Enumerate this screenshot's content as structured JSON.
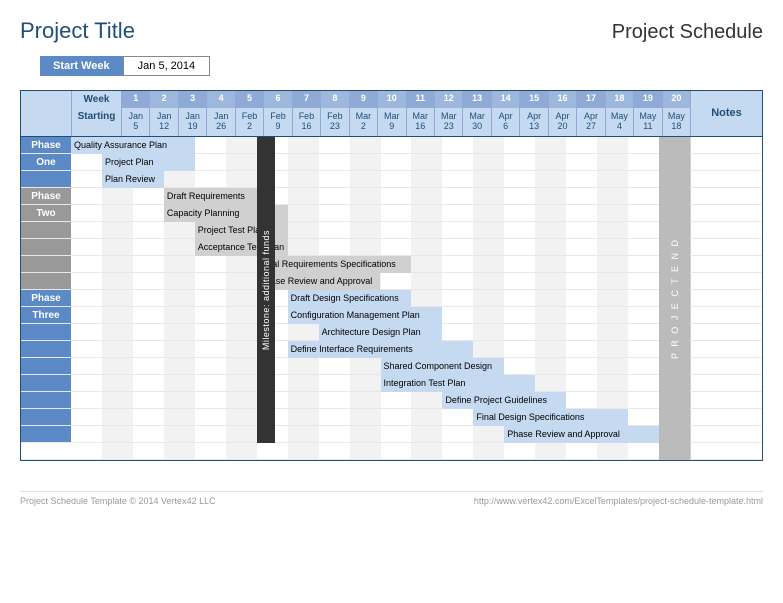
{
  "title": "Project Title",
  "subtitle": "Project Schedule",
  "start_week_label": "Start Week",
  "start_week_value": "Jan 5, 2014",
  "header": {
    "week_label": "Week",
    "starting_label": "Starting",
    "notes_label": "Notes",
    "weeks": [
      "1",
      "2",
      "3",
      "4",
      "5",
      "6",
      "7",
      "8",
      "9",
      "10",
      "11",
      "12",
      "13",
      "14",
      "15",
      "16",
      "17",
      "18",
      "19",
      "20"
    ],
    "dates": [
      "Jan 5",
      "Jan 12",
      "Jan 19",
      "Jan 26",
      "Feb 2",
      "Feb 9",
      "Feb 16",
      "Feb 23",
      "Mar 2",
      "Mar 9",
      "Mar 16",
      "Mar 23",
      "Mar 30",
      "Apr 6",
      "Apr 13",
      "Apr 20",
      "Apr 27",
      "May 4",
      "May 11",
      "May 18"
    ]
  },
  "phases": [
    {
      "name": "Phase",
      "sub": "One",
      "cls": "ph-one"
    },
    {
      "name": "Phase",
      "sub": "Two",
      "cls": "ph-two"
    },
    {
      "name": "Phase",
      "sub": "Three",
      "cls": "ph-three"
    }
  ],
  "chart_data": {
    "type": "bar",
    "xlabel": "Week",
    "categories": [
      "1",
      "2",
      "3",
      "4",
      "5",
      "6",
      "7",
      "8",
      "9",
      "10",
      "11",
      "12",
      "13",
      "14",
      "15",
      "16",
      "17",
      "18",
      "19",
      "20"
    ],
    "tasks": [
      {
        "row": 0,
        "start": 1,
        "span": 4,
        "label": "Quality Assurance Plan",
        "phase": 1
      },
      {
        "row": 1,
        "start": 2,
        "span": 3,
        "label": "Project Plan",
        "phase": 1
      },
      {
        "row": 2,
        "start": 2,
        "span": 2,
        "label": "Plan Review",
        "phase": 1
      },
      {
        "row": 3,
        "start": 4,
        "span": 3,
        "label": "Draft Requirements",
        "phase": 2
      },
      {
        "row": 4,
        "start": 4,
        "span": 4,
        "label": "Capacity Planning",
        "phase": 2
      },
      {
        "row": 5,
        "start": 5,
        "span": 3,
        "label": "Project Test Plan",
        "phase": 2
      },
      {
        "row": 6,
        "start": 5,
        "span": 3,
        "label": "Acceptance Test Plan",
        "phase": 2
      },
      {
        "row": 7,
        "start": 7,
        "span": 5,
        "label": "Final Requirements Specifications",
        "phase": 2
      },
      {
        "row": 8,
        "start": 7,
        "span": 4,
        "label": "Phase Review and Approval",
        "phase": 2
      },
      {
        "row": 9,
        "start": 8,
        "span": 4,
        "label": "Draft Design Specifications",
        "phase": 3
      },
      {
        "row": 10,
        "start": 8,
        "span": 5,
        "label": "Configuration Management Plan",
        "phase": 3
      },
      {
        "row": 11,
        "start": 9,
        "span": 4,
        "label": "Architecture Design Plan",
        "phase": 3
      },
      {
        "row": 12,
        "start": 8,
        "span": 6,
        "label": "Define Interface Requirements",
        "phase": 3
      },
      {
        "row": 13,
        "start": 11,
        "span": 4,
        "label": "Shared Component Design",
        "phase": 3
      },
      {
        "row": 14,
        "start": 11,
        "span": 5,
        "label": "Integration Test Plan",
        "phase": 3
      },
      {
        "row": 15,
        "start": 13,
        "span": 4,
        "label": "Define Project Guidelines",
        "phase": 3
      },
      {
        "row": 16,
        "start": 14,
        "span": 5,
        "label": "Final Design Specifications",
        "phase": 3
      },
      {
        "row": 17,
        "start": 15,
        "span": 5,
        "label": "Phase Review and Approval",
        "phase": 3
      }
    ],
    "milestones": [
      {
        "label": "Milestone: additional funds",
        "week": 7,
        "from_row": 0,
        "to_row": 17
      },
      {
        "label": "PROJECT END",
        "week": 20,
        "from_row": 0,
        "to_row": 17,
        "type": "end"
      }
    ]
  },
  "footer_left": "Project Schedule Template © 2014 Vertex42 LLC",
  "footer_right": "http://www.vertex42.com/ExcelTemplates/project-schedule-template.html"
}
